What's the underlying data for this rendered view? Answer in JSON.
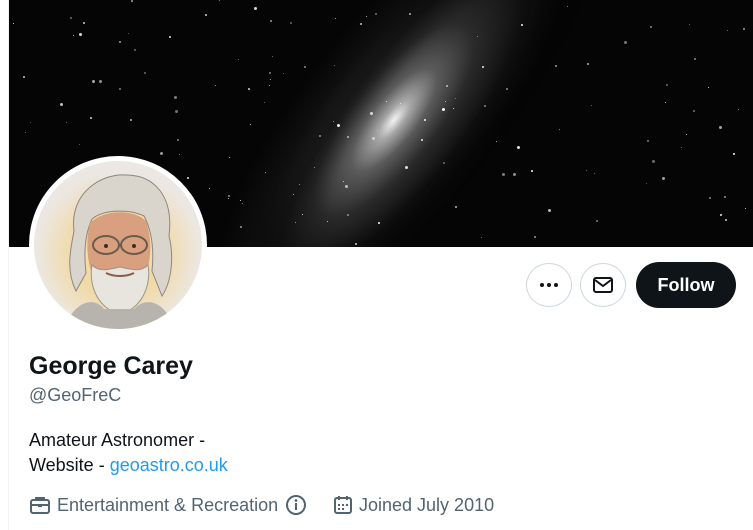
{
  "profile": {
    "name": "George Carey",
    "handle": "@GeoFreC",
    "bio_line1": "Amateur Astronomer -",
    "bio_line2_prefix": "Website - ",
    "bio_link": "geoastro.co.uk",
    "category": "Entertainment & Recreation",
    "joined": "Joined July 2010"
  },
  "actions": {
    "follow_label": "Follow",
    "more_icon": "more-horizontal-icon",
    "message_icon": "envelope-icon"
  },
  "colors": {
    "link": "#1d9bf0",
    "secondary_text": "#536471",
    "primary_text": "#0f1419",
    "follow_bg": "#0f1419"
  }
}
